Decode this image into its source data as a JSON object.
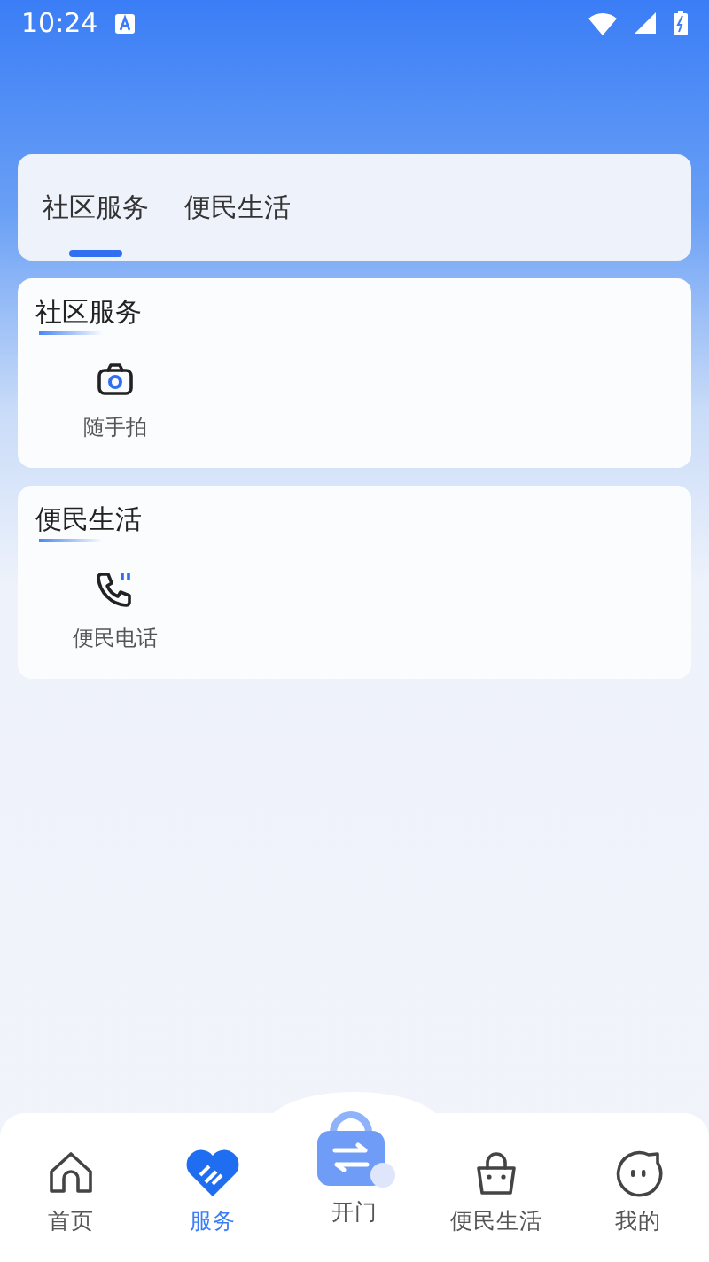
{
  "status_bar": {
    "time": "10:24"
  },
  "tabs": [
    {
      "label": "社区服务",
      "selected": true
    },
    {
      "label": "便民生活",
      "selected": false
    }
  ],
  "sections": [
    {
      "title": "社区服务",
      "items": [
        {
          "label": "随手拍",
          "kind": "camera"
        }
      ]
    },
    {
      "title": "便民生活",
      "items": [
        {
          "label": "便民电话",
          "kind": "phone"
        }
      ]
    }
  ],
  "nav": [
    {
      "label": "首页",
      "kind": "home",
      "selected": false
    },
    {
      "label": "服务",
      "kind": "heart",
      "selected": true
    },
    {
      "label": "开门",
      "kind": "door",
      "selected": false
    },
    {
      "label": "便民生活",
      "kind": "bag",
      "selected": false
    },
    {
      "label": "我的",
      "kind": "face",
      "selected": false
    }
  ]
}
